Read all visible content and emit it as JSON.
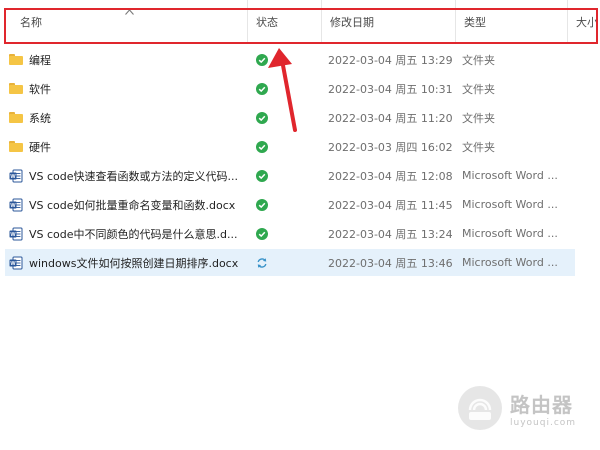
{
  "columns": {
    "name": "名称",
    "status": "状态",
    "modified": "修改日期",
    "type": "类型",
    "size": "大小"
  },
  "files": [
    {
      "name": "编程",
      "date": "2022-03-04 周五 13:29",
      "type": "文件夹",
      "icon": "folder-icon",
      "status": "synced-check-icon"
    },
    {
      "name": "软件",
      "date": "2022-03-04 周五 10:31",
      "type": "文件夹",
      "icon": "folder-icon",
      "status": "synced-check-icon"
    },
    {
      "name": "系统",
      "date": "2022-03-04 周五 11:20",
      "type": "文件夹",
      "icon": "folder-icon",
      "status": "synced-check-icon"
    },
    {
      "name": "硬件",
      "date": "2022-03-03 周四 16:02",
      "type": "文件夹",
      "icon": "folder-icon",
      "status": "synced-check-icon"
    },
    {
      "name": "VS code快速查看函数或方法的定义代码...",
      "date": "2022-03-04 周五 12:08",
      "type": "Microsoft Word ...",
      "icon": "word-doc-icon",
      "status": "synced-check-icon"
    },
    {
      "name": "VS code如何批量重命名变量和函数.docx",
      "date": "2022-03-04 周五 11:45",
      "type": "Microsoft Word ...",
      "icon": "word-doc-icon",
      "status": "synced-check-icon"
    },
    {
      "name": "VS code中不同颜色的代码是什么意思.d...",
      "date": "2022-03-04 周五 13:24",
      "type": "Microsoft Word ...",
      "icon": "word-doc-icon",
      "status": "synced-check-icon"
    },
    {
      "name": "windows文件如何按照创建日期排序.docx",
      "date": "2022-03-04 周五 13:46",
      "type": "Microsoft Word ...",
      "icon": "word-doc-icon",
      "status": "syncing-icon"
    }
  ],
  "watermark": {
    "text": "路由器",
    "subtext": "luyouqi.com"
  },
  "colors": {
    "highlight": "#e0262d",
    "selected_row": "#e5f1fb",
    "check": "#2fa84f",
    "sync": "#3a93c9"
  }
}
